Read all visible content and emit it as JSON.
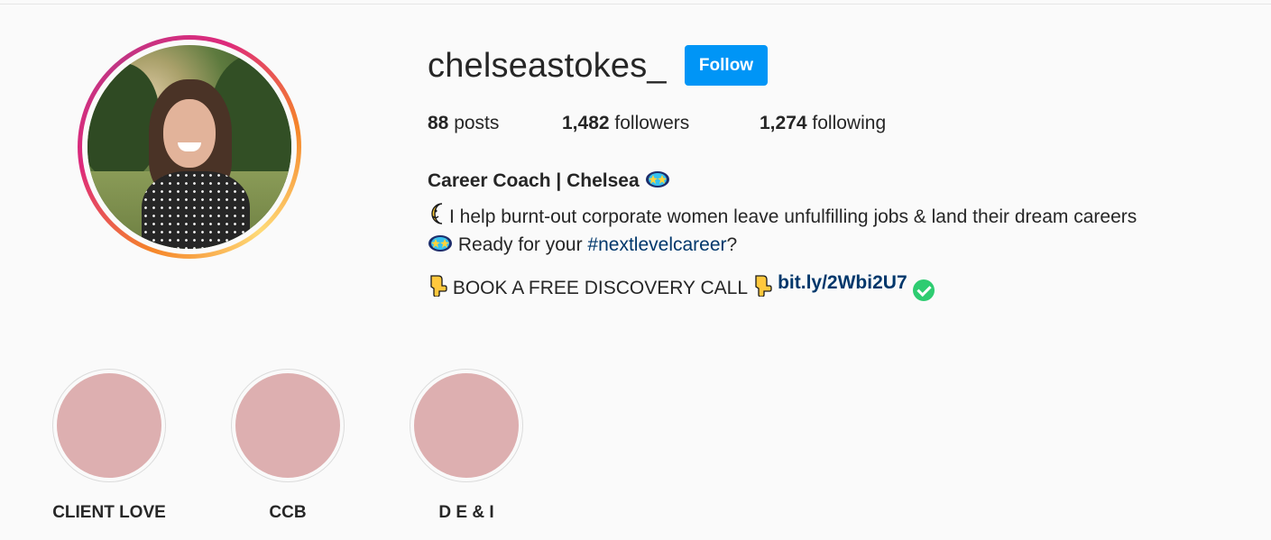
{
  "profile": {
    "username": "chelseastokes_",
    "follow_label": "Follow",
    "stats": {
      "posts_count": "88",
      "posts_label": "posts",
      "followers_count": "1,482",
      "followers_label": "followers",
      "following_count": "1,274",
      "following_label": "following"
    },
    "bio": {
      "name": "Career Coach | Chelsea",
      "line1": "I help burnt-out corporate women leave unfulfilling jobs & land their dream careers",
      "line2_prefix": "Ready for your ",
      "line2_hashtag": "#nextlevelcareer",
      "line2_suffix": "?",
      "line3": "BOOK A FREE DISCOVERY CALL",
      "link": "bit.ly/2Wbi2U7"
    }
  },
  "highlights": [
    {
      "label": "CLIENT LOVE",
      "color": "#ddafb0"
    },
    {
      "label": "CCB",
      "color": "#ddafb0"
    },
    {
      "label": "D E & I",
      "color": "#ddafb0"
    }
  ],
  "icons": {
    "star_eyes": "star-struck-emoji",
    "moon": "crescent-moon-emoji",
    "point_down": "backhand-index-pointing-down-emoji",
    "verified": "check-circle-icon"
  },
  "colors": {
    "follow_button": "#0095f6",
    "link": "#00376b",
    "highlight_fill": "#ddafb0"
  }
}
